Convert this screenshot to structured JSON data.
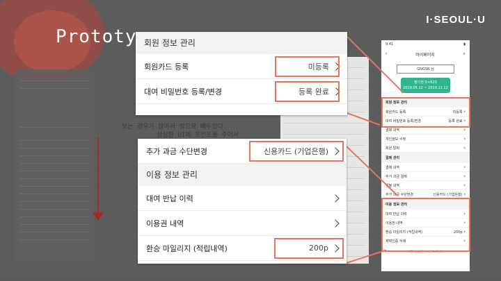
{
  "slide": {
    "title": "Prototy",
    "logo": "I·SEOUL·U",
    "faded_lines": [
      "보는 경우가 많아서 밖으로 빼두었다.",
      "심심한 UI에 포인트를 주어서"
    ]
  },
  "top_panel": {
    "section_title": "회원 정보 관리",
    "rows": [
      {
        "label": "회원카드 등록",
        "value": "미등록"
      },
      {
        "label": "대여 비밀번호 등록/변경",
        "value": "등록 완료"
      }
    ]
  },
  "bottom_panel": {
    "first_row": {
      "label": "추가 과금 수단변경",
      "value": "신용카드 (기업은행)"
    },
    "section_title": "이용 정보 관리",
    "rows": [
      {
        "label": "대여 반납 이력",
        "value": ""
      },
      {
        "label": "이용권 내역",
        "value": ""
      },
      {
        "label": "환승 마일리지 (적립내역)",
        "value": "200p"
      }
    ]
  },
  "phone_right": {
    "status_time": "9:41",
    "nav_title": "마이페이지",
    "user": "GNGSN 님",
    "ticket_title": "정기권 D+623",
    "ticket_sub": "2019.05.22 ~ 2019.11.12",
    "sections": [
      {
        "title": "회원 정보 관리",
        "rows": [
          {
            "label": "회원카드 등록",
            "value": "미등록"
          },
          {
            "label": "대여 비밀번호 등록/변경",
            "value": "등록 완료"
          }
        ]
      },
      {
        "title": "",
        "rows": [
          {
            "label": "결제 내역",
            "value": ""
          },
          {
            "label": "개인정보 수정",
            "value": ""
          },
          {
            "label": "회원 탈퇴",
            "value": ""
          }
        ]
      },
      {
        "title": "결제 관리",
        "rows": [
          {
            "label": "결제 내역",
            "value": ""
          },
          {
            "label": "추가 과금 결제",
            "value": ""
          },
          {
            "label": "환불 내역",
            "value": ""
          },
          {
            "label": "추가 과금 수단변경",
            "value": "신용카드 (기업은행)"
          }
        ]
      },
      {
        "title": "이용 정보 관리",
        "rows": [
          {
            "label": "대여 반납 이력",
            "value": ""
          },
          {
            "label": "이용권 내역",
            "value": ""
          },
          {
            "label": "환승 마일리지 (적립내역)",
            "value": "200p"
          },
          {
            "label": "재택인증 삭제",
            "value": ""
          }
        ]
      }
    ],
    "footer": "서울시설공단 온라인 고객센터"
  }
}
